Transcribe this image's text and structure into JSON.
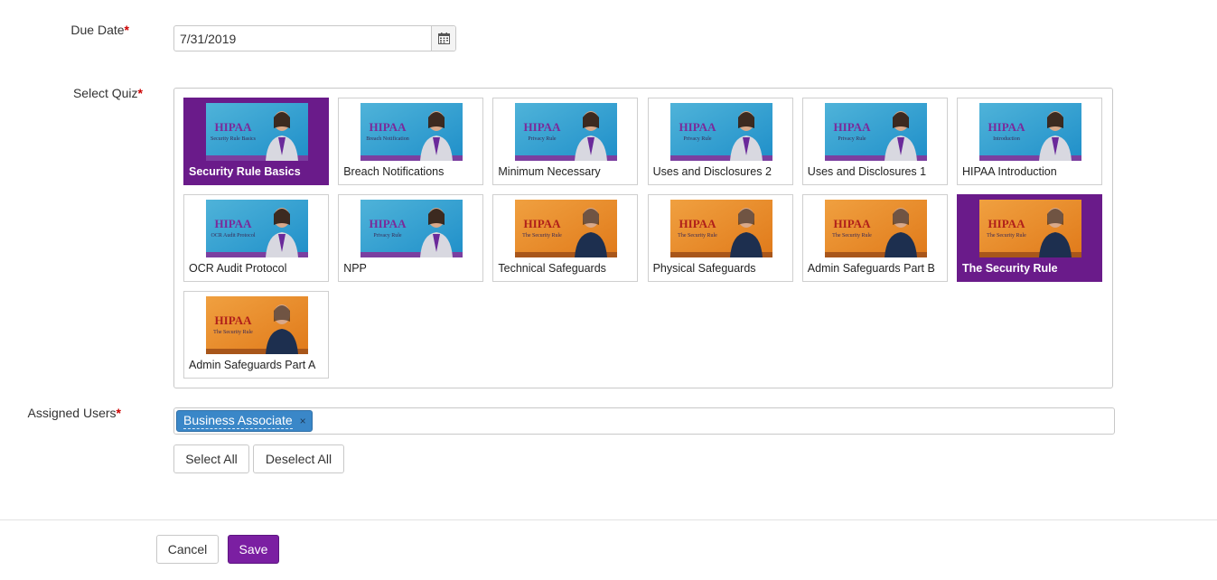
{
  "form": {
    "due_date": {
      "label": "Due Date",
      "required_mark": "*",
      "value": "7/31/2019"
    },
    "quiz": {
      "label": "Select Quiz",
      "required_mark": "*",
      "items": [
        {
          "title": "Security Rule Basics",
          "selected": true,
          "theme": "blue",
          "thumb_title": "HIPAA",
          "thumb_sub": "Security Rule Basics"
        },
        {
          "title": "Breach Notifications",
          "selected": false,
          "theme": "blue",
          "thumb_title": "HIPAA",
          "thumb_sub": "Breach Notification"
        },
        {
          "title": "Minimum Necessary",
          "selected": false,
          "theme": "blue",
          "thumb_title": "HIPAA",
          "thumb_sub": "Privacy Rule"
        },
        {
          "title": "Uses and Disclosures 2",
          "selected": false,
          "theme": "blue",
          "thumb_title": "HIPAA",
          "thumb_sub": "Privacy Rule"
        },
        {
          "title": "Uses and Disclosures 1",
          "selected": false,
          "theme": "blue",
          "thumb_title": "HIPAA",
          "thumb_sub": "Privacy Rule"
        },
        {
          "title": "HIPAA Introduction",
          "selected": false,
          "theme": "blue",
          "thumb_title": "HIPAA",
          "thumb_sub": "Introduction"
        },
        {
          "title": "OCR Audit Protocol",
          "selected": false,
          "theme": "blue",
          "thumb_title": "HIPAA",
          "thumb_sub": "OCR Audit Protocol"
        },
        {
          "title": "NPP",
          "selected": false,
          "theme": "blue",
          "thumb_title": "HIPAA",
          "thumb_sub": "Privacy Rule"
        },
        {
          "title": "Technical Safeguards",
          "selected": false,
          "theme": "orange",
          "thumb_title": "HIPAA",
          "thumb_sub": "The Security Rule"
        },
        {
          "title": "Physical Safeguards",
          "selected": false,
          "theme": "orange",
          "thumb_title": "HIPAA",
          "thumb_sub": "The Security Rule"
        },
        {
          "title": "Admin Safeguards Part B",
          "selected": false,
          "theme": "orange",
          "thumb_title": "HIPAA",
          "thumb_sub": "The Security Rule"
        },
        {
          "title": "The Security Rule",
          "selected": true,
          "theme": "orange",
          "thumb_title": "HIPAA",
          "thumb_sub": "The Security Rule"
        },
        {
          "title": "Admin Safeguards Part A",
          "selected": false,
          "theme": "orange",
          "thumb_title": "HIPAA",
          "thumb_sub": "The Security Rule"
        }
      ]
    },
    "assigned_users": {
      "label": "Assigned Users",
      "required_mark": "*",
      "tags": [
        {
          "label": "Business Associate",
          "remove_glyph": "×"
        }
      ],
      "select_all_label": "Select All",
      "deselect_all_label": "Deselect All"
    }
  },
  "footer": {
    "cancel_label": "Cancel",
    "save_label": "Save"
  },
  "colors": {
    "accent": "#7b1fa2",
    "selected_tile": "#6a1b8a",
    "tag": "#3a87c8",
    "required": "#cc0000"
  },
  "icons": {
    "date_picker": "calendar-icon"
  }
}
